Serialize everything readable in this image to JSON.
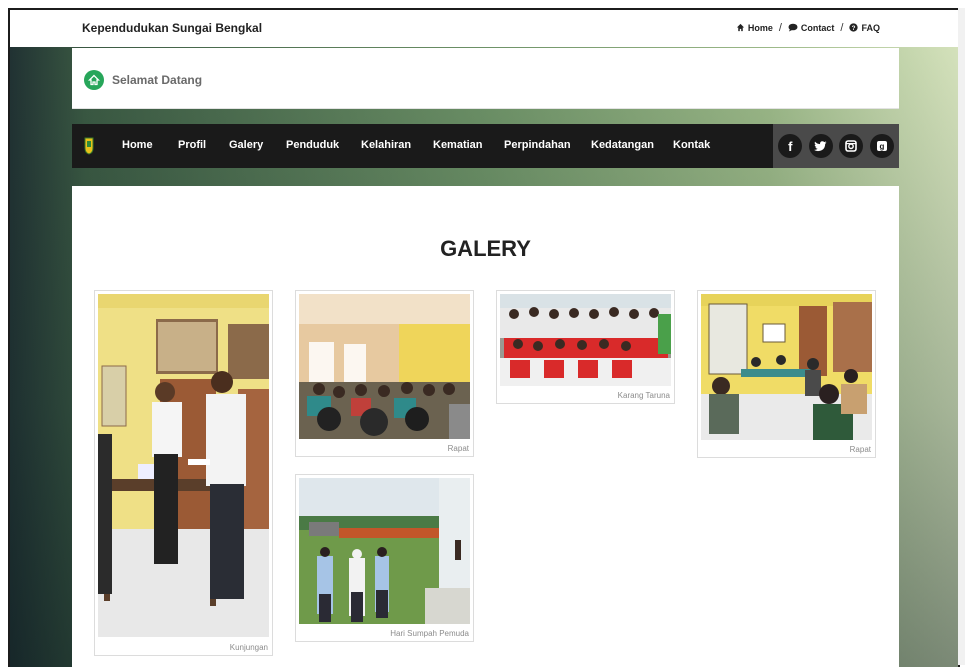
{
  "header": {
    "site_name": "Kependudukan Sungai Bengkal",
    "links": [
      {
        "icon": "home-icon",
        "label": "Home"
      },
      {
        "icon": "comment-icon",
        "label": "Contact"
      },
      {
        "icon": "question-icon",
        "label": "FAQ"
      }
    ],
    "separator": "/"
  },
  "welcome": {
    "text": "Selamat Datang"
  },
  "nav": {
    "items": [
      "Home",
      "Profil",
      "Galery",
      "Penduduk",
      "Kelahiran",
      "Kematian",
      "Perpindahan",
      "Kedatangan",
      "Kontak"
    ],
    "social": [
      {
        "icon": "facebook-icon",
        "glyph": "f"
      },
      {
        "icon": "twitter-icon",
        "glyph": "t"
      },
      {
        "icon": "instagram-icon",
        "glyph": "◘"
      },
      {
        "icon": "google-plus-icon",
        "glyph": "g"
      }
    ]
  },
  "gallery": {
    "title": "GALERY",
    "items": [
      {
        "caption": "Kunjungan"
      },
      {
        "caption": "Rapat"
      },
      {
        "caption": "Karang Taruna"
      },
      {
        "caption": "Rapat"
      },
      {
        "caption": "Hari Sumpah Pemuda"
      }
    ]
  },
  "colors": {
    "accent_green": "#27a65a",
    "navbar": "#1a1a1a",
    "social_bg": "#4a4a4a"
  }
}
